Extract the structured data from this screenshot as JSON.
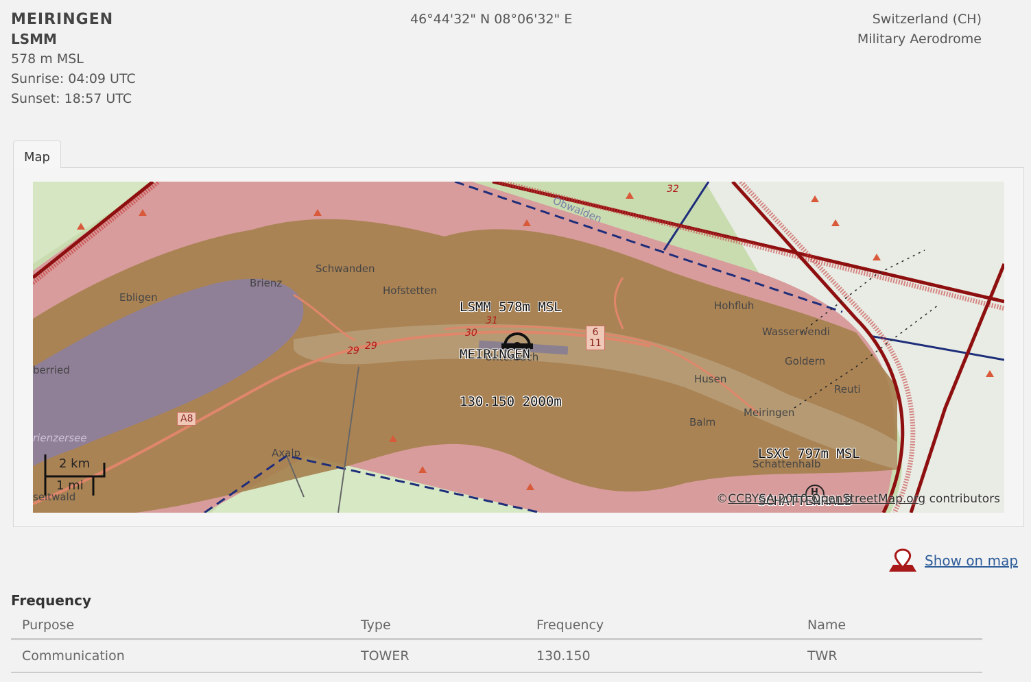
{
  "airport": {
    "name": "MEIRINGEN",
    "icao": "LSMM",
    "elevation": "578 m MSL",
    "sunrise": "Sunrise: 04:09 UTC",
    "sunset": "Sunset: 18:57 UTC",
    "coordinates": "46°44'32\" N 08°06'32\" E",
    "country": "Switzerland (CH)",
    "type": "Military Aerodrome"
  },
  "tabs": [
    {
      "label": "Map"
    }
  ],
  "map": {
    "places": {
      "schwanden": "Schwanden",
      "brienz": "Brienz",
      "ebligen": "Ebligen",
      "hofstetten": "Hofstetten",
      "oberried": "berried",
      "hohfluh": "Hohfluh",
      "wasserwendi": "Wasserwendi",
      "goldern": "Goldern",
      "husen": "Husen",
      "reuti": "Reuti",
      "balm": "Balm",
      "meiringen": "Meiringen",
      "schattenhalb": "Schattenhalb",
      "axalp": "Axalp",
      "brienzersee": "rienzersee",
      "iseltwald": "seltwald",
      "unterbach": "Unterbach",
      "obwalden": "Obwalden"
    },
    "roads": {
      "r29a": "29",
      "r29b": "29",
      "r30": "30",
      "r31": "31",
      "r32": "32",
      "a8": "A8",
      "sign_top": "6",
      "sign_bottom": "11"
    },
    "airport_label": {
      "line1": "LSMM 578m MSL",
      "line2": "MEIRINGEN",
      "line3": "130.150 2000m"
    },
    "second_airport_label": {
      "line1": "LSXC 797m MSL",
      "line2": "SCHATTENHALB"
    },
    "heliport_marker": "H",
    "scale": {
      "km": "2 km",
      "mi": "1 mi"
    },
    "copyright": {
      "prefix": "©",
      "license": "CCBYSA",
      "year": " 2010 ",
      "osm": "OpenStreetMap.org",
      "suffix": " contributors"
    }
  },
  "show_on_map": {
    "label": "Show on map",
    "icon": "map-pin-icon"
  },
  "frequency": {
    "heading": "Frequency",
    "columns": {
      "purpose": "Purpose",
      "type": "Type",
      "frequency": "Frequency",
      "name": "Name"
    },
    "rows": [
      {
        "purpose": "Communication",
        "type": "TOWER",
        "frequency": "130.150",
        "name": "TWR"
      }
    ]
  },
  "colors": {
    "restricted_fill": "#d99a9a",
    "terrain": "#a57f52",
    "lake": "#8e7f96",
    "boundary_red": "#8e0f0f",
    "boundary_blue": "#1e2d7a",
    "link": "#2e5d9a",
    "pin": "#a81818"
  }
}
